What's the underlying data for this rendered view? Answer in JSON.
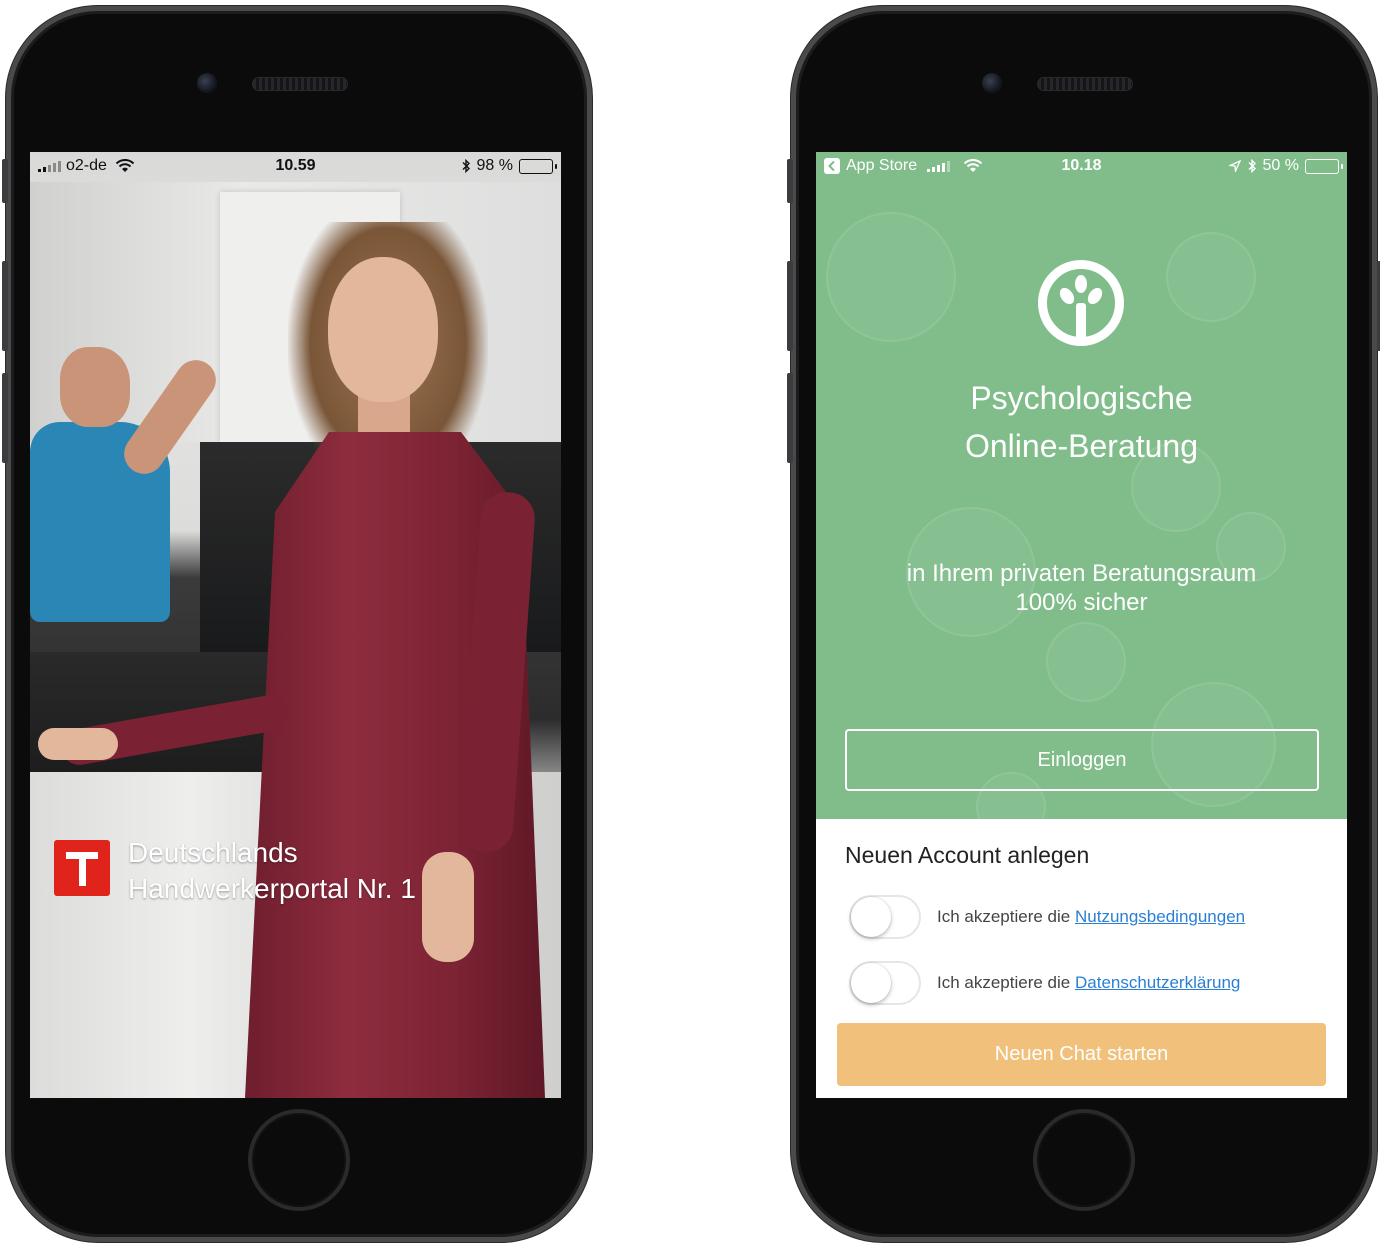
{
  "left_phone": {
    "status": {
      "carrier": "o2-de",
      "time": "10.59",
      "battery_text": "98 %",
      "battery_level": 0.98
    },
    "brand": {
      "line1": "Deutschlands",
      "line2": "Handwerkerportal Nr. 1"
    }
  },
  "right_phone": {
    "status": {
      "back_app": "App Store",
      "time": "10.18",
      "battery_text": "50 %",
      "battery_level": 0.5
    },
    "hero": {
      "title_line1": "Psychologische",
      "title_line2": "Online-Beratung",
      "subtitle_line1": "in Ihrem privaten Beratungsraum",
      "subtitle_line2": "100% sicher",
      "login_label": "Einloggen"
    },
    "signup": {
      "title": "Neuen Account anlegen",
      "accept_prefix": "Ich akzeptiere die",
      "terms_link": "Nutzungsbedingungen",
      "privacy_link": "Datenschutzerklärung",
      "terms_accepted": false,
      "privacy_accepted": false,
      "start_label": "Neuen Chat starten"
    }
  },
  "colors": {
    "brand_green": "#80bd8a",
    "cta_orange": "#f1c07b",
    "link_blue": "#2a7fd4",
    "logo_red": "#e0231b"
  }
}
